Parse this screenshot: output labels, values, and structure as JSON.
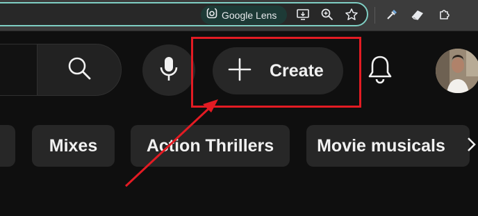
{
  "browser": {
    "lens_label": "Google Lens",
    "icons": [
      "google-lens-icon",
      "install-app-icon",
      "zoom-icon",
      "bookmark-star-icon",
      "eyedropper-extension-icon",
      "eraser-extension-icon",
      "extensions-puzzle-icon"
    ]
  },
  "header": {
    "create_label": "Create",
    "icons": [
      "search-icon",
      "microphone-icon",
      "plus-icon",
      "bell-icon"
    ],
    "avatar": "avatar"
  },
  "chips": [
    {
      "label": ""
    },
    {
      "label": "Mixes"
    },
    {
      "label": "Action Thrillers"
    },
    {
      "label": "Movie musicals"
    }
  ],
  "annotation": {
    "highlight_color": "#e31b23",
    "arrow_color": "#e31b23"
  },
  "colors": {
    "background": "#0f0f0f",
    "chip_bg": "#272727",
    "omnibox_border": "#7fcfc4",
    "lens_chip_bg": "#1d3a36"
  }
}
